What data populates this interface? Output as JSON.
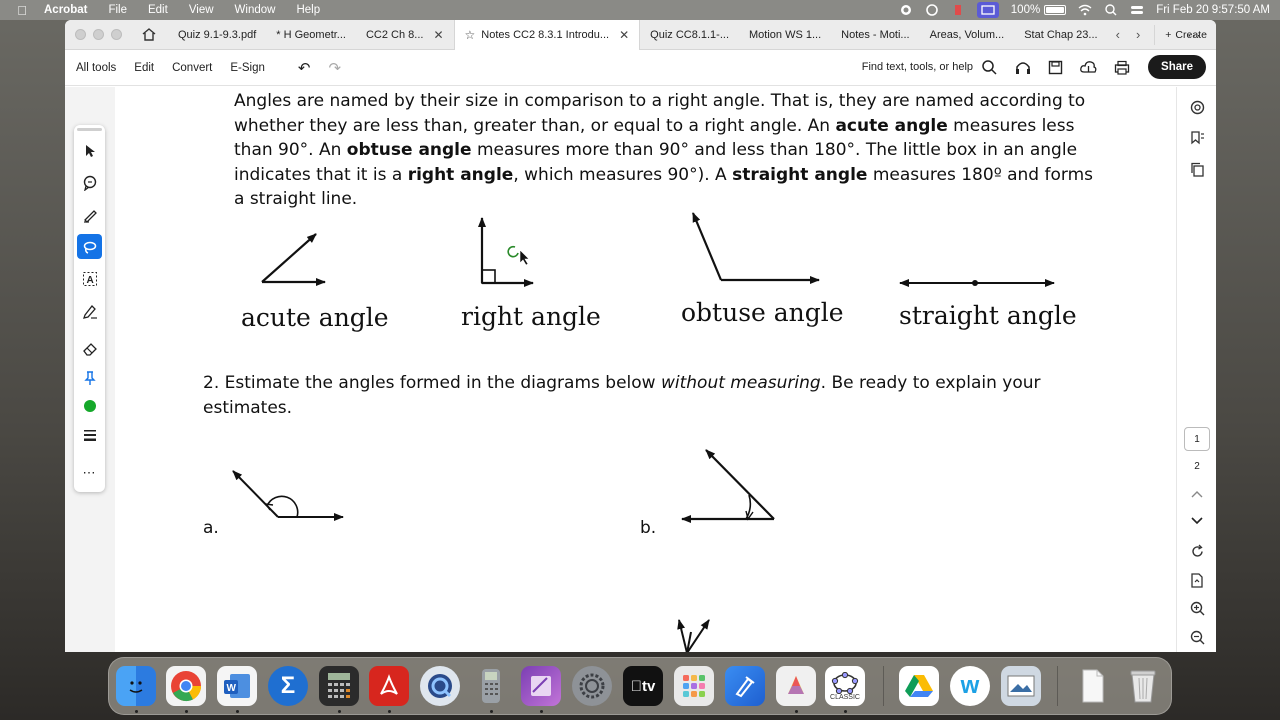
{
  "menubar": {
    "app": "Acrobat",
    "items": [
      "File",
      "Edit",
      "View",
      "Window",
      "Help"
    ],
    "battery": "100%",
    "datetime": "Fri Feb 20  9:57:50 AM"
  },
  "tabs": [
    {
      "label": "Quiz 9.1-9.3.pdf"
    },
    {
      "label": "* H Geometr..."
    },
    {
      "label": "CC2 Ch 8..."
    },
    {
      "label": "Notes CC2 8.3.1 Introdu..."
    },
    {
      "label": "Quiz CC8.1.1-..."
    },
    {
      "label": "Motion WS 1..."
    },
    {
      "label": "Notes - Moti..."
    },
    {
      "label": "Areas, Volum..."
    },
    {
      "label": "Stat Chap 23..."
    }
  ],
  "create_label": "Create",
  "toolbar": {
    "all_tools": "All tools",
    "edit": "Edit",
    "convert": "Convert",
    "esign": "E-Sign",
    "find": "Find text, tools, or help",
    "share": "Share"
  },
  "document": {
    "para1_lines": [
      "Angles are named by their size in comparison to a right angle.  That is, they are named according to",
      "whether they are less than, greater than, or equal to a right angle.  An ",
      "acute angle",
      " measures less",
      "than 90°.  An ",
      "obtuse angle",
      " measures more than 90° and less than 180°.  The little box in an angle",
      "indicates that it is a ",
      "right angle",
      ", which measures 90°).  A ",
      "straight angle",
      " measures 180º and forms",
      "a straight line."
    ],
    "figure_labels": [
      "acute angle",
      "right angle",
      "obtuse angle",
      "straight angle"
    ],
    "q2_line1_start": "2.  Estimate the angles formed in the diagrams below ",
    "q2_italic": "without measuring",
    "q2_line1_end": ".  Be ready to explain your",
    "q2_line2": "estimates.",
    "label_a": "a.",
    "label_b": "b."
  },
  "pages": [
    "1",
    "2"
  ],
  "dock": {
    "apps": [
      "finder-icon",
      "chrome-icon",
      "word-icon",
      "sigma-icon",
      "calculator-icon",
      "acrobat-icon",
      "quicktime-icon",
      "graphing-calculator-icon",
      "onenote-icon",
      "system-settings-icon",
      "apple-tv-icon",
      "launchpad-icon",
      "pen-tool-icon",
      "color-icon",
      "geogebra-icon",
      "google-drive-icon",
      "w-icon",
      "preview-icon",
      "document-icon",
      "trash-icon"
    ],
    "classic_label": "CLASSIC",
    "tv_label": "tv"
  }
}
